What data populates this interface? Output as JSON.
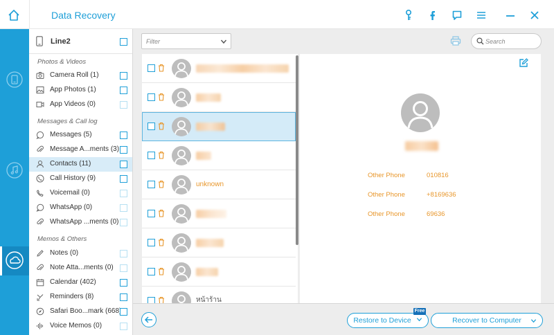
{
  "app": {
    "title": "Data Recovery",
    "accent": "#1e9fd8",
    "icons": [
      "home-icon",
      "key-icon",
      "facebook-icon",
      "chat-icon",
      "menu-icon",
      "minimize-icon",
      "close-icon"
    ]
  },
  "rail": {
    "items": [
      {
        "icon": "phone-recover-icon",
        "active": false
      },
      {
        "icon": "itunes-icon",
        "active": false
      },
      {
        "icon": "icloud-icon",
        "active": true
      }
    ]
  },
  "sidebar": {
    "device": {
      "name": "Line2"
    },
    "sections": [
      {
        "title": "Photos & Videos"
      },
      {
        "title": "Messages & Call log"
      },
      {
        "title": "Memos & Others"
      }
    ],
    "items": [
      {
        "label": "Camera Roll (1)",
        "icon": "camera-icon"
      },
      {
        "label": "App Photos (1)",
        "icon": "image-icon"
      },
      {
        "label": "App Videos (0)",
        "icon": "video-icon"
      },
      {
        "label": "Messages (5)",
        "icon": "message-icon"
      },
      {
        "label": "Message A...ments (3)",
        "icon": "paperclip-icon"
      },
      {
        "label": "Contacts (11)",
        "icon": "contact-icon"
      },
      {
        "label": "Call History (9)",
        "icon": "phone-icon"
      },
      {
        "label": "Voicemail (0)",
        "icon": "voicemail-icon"
      },
      {
        "label": "WhatsApp (0)",
        "icon": "whatsapp-icon"
      },
      {
        "label": "WhatsApp ...ments (0)",
        "icon": "paperclip-icon"
      },
      {
        "label": "Notes (0)",
        "icon": "note-icon"
      },
      {
        "label": "Note Atta...ments (0)",
        "icon": "paperclip-icon"
      },
      {
        "label": "Calendar (402)",
        "icon": "calendar-icon"
      },
      {
        "label": "Reminders (8)",
        "icon": "reminder-icon"
      },
      {
        "label": "Safari Boo...mark (668)",
        "icon": "bookmark-icon"
      },
      {
        "label": "Voice Memos (0)",
        "icon": "voice-memo-icon"
      }
    ]
  },
  "toolbar": {
    "filter_placeholder": "Filter",
    "search_placeholder": "Search"
  },
  "contacts": {
    "rows": [
      {
        "name": ""
      },
      {
        "name": ""
      },
      {
        "name": ""
      },
      {
        "name": ""
      },
      {
        "name": "unknown"
      },
      {
        "name": ""
      },
      {
        "name": ""
      },
      {
        "name": ""
      },
      {
        "name": "หน้าร้าน"
      }
    ]
  },
  "detail": {
    "fields": [
      {
        "label": "Other Phone",
        "value": "010816"
      },
      {
        "label": "Other Phone",
        "value": "+8169636"
      },
      {
        "label": "Other Phone",
        "value": "69636"
      }
    ]
  },
  "bottom": {
    "restore_label": "Restore to Device",
    "free_badge": "Free",
    "recover_label": "Recover to Computer"
  }
}
